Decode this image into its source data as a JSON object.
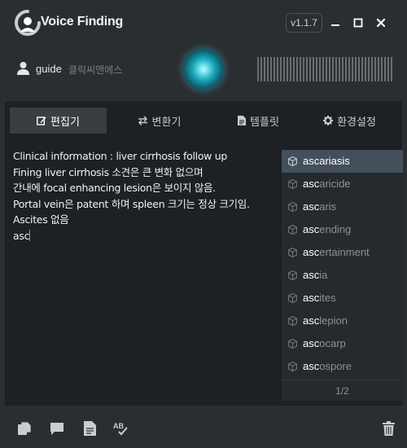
{
  "app": {
    "name": "Voice Finding",
    "version": "v1.1.7"
  },
  "user": {
    "name": "guide",
    "org": "클릭씨앤에스"
  },
  "tabs": [
    {
      "label": "편집기",
      "icon": "edit-icon",
      "active": true
    },
    {
      "label": "변환기",
      "icon": "swap-arrows-icon",
      "active": false
    },
    {
      "label": "템플릿",
      "icon": "document-icon",
      "active": false
    },
    {
      "label": "환경설정",
      "icon": "gear-icon",
      "active": false
    }
  ],
  "editor": {
    "lines": [
      "Clinical information : liver cirrhosis follow up",
      "Fining liver cirrhosis 소견은 큰 변화 없으며",
      "간내에 focal enhancing lesion은 보이지 않음.",
      "Portal vein은 patent 하며 spleen 크기는 정상 크기임.",
      "Ascites 없음",
      "asc"
    ]
  },
  "suggestions": {
    "prefix": "asc",
    "items": [
      {
        "match": "asc",
        "rest": "ariasis"
      },
      {
        "match": "asc",
        "rest": "aricide"
      },
      {
        "match": "asc",
        "rest": "aris"
      },
      {
        "match": "asc",
        "rest": "ending"
      },
      {
        "match": "asc",
        "rest": "ertainment"
      },
      {
        "match": "asc",
        "rest": "ia"
      },
      {
        "match": "asc",
        "rest": "ites"
      },
      {
        "match": "asc",
        "rest": "lepion"
      },
      {
        "match": "asc",
        "rest": "ocarp"
      },
      {
        "match": "asc",
        "rest": "ospore"
      }
    ],
    "selected_index": 0,
    "page": "1/2"
  },
  "colors": {
    "background": "#2b2e31",
    "panel": "#1d2024",
    "selected": "#43505c",
    "accent": "#3fb9d8"
  },
  "footer_icons": [
    "copy-icon",
    "comment-icon",
    "document-icon",
    "spellcheck-icon",
    "trash-icon"
  ]
}
